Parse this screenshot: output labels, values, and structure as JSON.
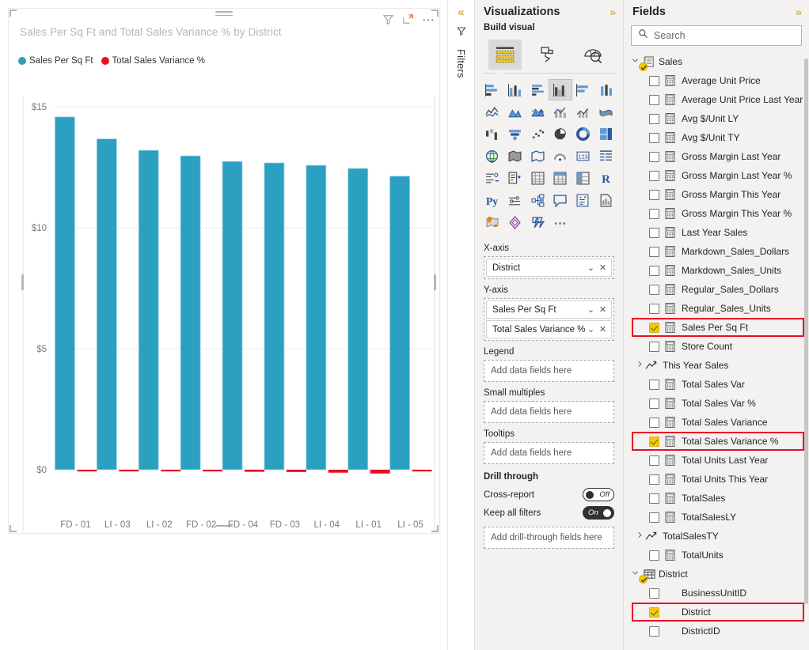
{
  "canvas": {
    "visual": {
      "title": "Sales Per Sq Ft and Total Sales Variance % by District",
      "header_icons": [
        {
          "name": "filter-icon",
          "label": "Filters"
        },
        {
          "name": "focus-mode-icon",
          "label": "Focus mode"
        },
        {
          "name": "more-options-icon",
          "label": "More options"
        }
      ],
      "legend": [
        {
          "label": "Sales Per Sq Ft",
          "color": "#2ba0c0"
        },
        {
          "label": "Total Sales Variance %",
          "color": "#e81123"
        }
      ]
    }
  },
  "chart_data": {
    "type": "bar",
    "title": "Sales Per Sq Ft and Total Sales Variance % by District",
    "xlabel": "District",
    "ylabel": "",
    "categories": [
      "FD - 01",
      "LI - 03",
      "LI - 02",
      "FD - 02",
      "FD - 04",
      "FD - 03",
      "LI - 04",
      "LI - 01",
      "LI - 05"
    ],
    "ytick_labels": [
      "$0",
      "$5",
      "$10",
      "$15"
    ],
    "ylim": [
      0,
      15
    ],
    "grid": true,
    "legend_position": "top-left",
    "series": [
      {
        "name": "Sales Per Sq Ft",
        "color": "#2ba0c0",
        "values": [
          14.58,
          13.67,
          13.2,
          12.97,
          12.74,
          12.68,
          12.58,
          12.45,
          12.13
        ]
      },
      {
        "name": "Total Sales Variance %",
        "color": "#e81123",
        "values": [
          -0.06,
          -0.07,
          -0.09,
          -0.08,
          -0.12,
          -0.13,
          -0.17,
          -0.22,
          -0.05
        ],
        "render": "thin-bar-near-zero"
      }
    ]
  },
  "filters_rail": {
    "expand_label": "«",
    "filter_icon": "filter-icon",
    "label": "Filters"
  },
  "visualizations": {
    "title": "Visualizations",
    "collapse_label": "»",
    "build_visual_label": "Build visual",
    "build_tabs": [
      {
        "name": "build-visual-tab",
        "icon": "fields-list-icon",
        "active": true
      },
      {
        "name": "format-visual-tab",
        "icon": "paint-roller-icon",
        "active": false
      },
      {
        "name": "analytics-tab",
        "icon": "magnifier-chart-icon",
        "active": false
      }
    ],
    "gallery_icons": [
      "stacked-bar-chart",
      "stacked-column-chart",
      "clustered-bar-chart",
      "clustered-column-chart",
      "100-stacked-bar-chart",
      "100-stacked-column-chart",
      "line-chart",
      "area-chart",
      "stacked-area-chart",
      "line-and-stacked-column-chart",
      "line-and-clustered-column-chart",
      "ribbon-chart",
      "waterfall-chart",
      "funnel-chart",
      "scatter-chart",
      "pie-chart",
      "donut-chart",
      "treemap",
      "map",
      "filled-map",
      "shape-map",
      "azure-map",
      "gauge",
      "card",
      "multi-row-card",
      "kpi",
      "slicer",
      "table",
      "matrix",
      "r-script-visual",
      "python-visual",
      "key-influencers",
      "decomposition-tree",
      "qa-visual",
      "smart-narrative",
      "paginated-report",
      "arcgis-map",
      "power-apps-visual",
      "power-automate-visual",
      "get-more-visuals"
    ],
    "wells": [
      {
        "label": "X-axis",
        "name": "x-axis-well",
        "fields": [
          {
            "text": "District"
          }
        ]
      },
      {
        "label": "Y-axis",
        "name": "y-axis-well",
        "fields": [
          {
            "text": "Sales Per Sq Ft"
          },
          {
            "text": "Total Sales Variance %"
          }
        ]
      },
      {
        "label": "Legend",
        "name": "legend-well",
        "placeholder": "Add data fields here",
        "fields": []
      },
      {
        "label": "Small multiples",
        "name": "small-multiples-well",
        "placeholder": "Add data fields here",
        "fields": []
      },
      {
        "label": "Tooltips",
        "name": "tooltips-well",
        "placeholder": "Add data fields here",
        "fields": []
      }
    ],
    "drill_through": {
      "heading": "Drill through",
      "cross_report": {
        "label": "Cross-report",
        "state": "Off",
        "on": false
      },
      "keep_all_filters": {
        "label": "Keep all filters",
        "state": "On",
        "on": true
      },
      "placeholder": "Add drill-through fields here"
    }
  },
  "fields": {
    "title": "Fields",
    "collapse_label": "»",
    "search_placeholder": "Search",
    "tables": [
      {
        "name": "Sales",
        "expanded": true,
        "checked": true,
        "icon": "table-measure-icon",
        "items": [
          {
            "label": "Average Unit Price",
            "checked": false,
            "icon": "measure-icon",
            "highlight": false
          },
          {
            "label": "Average Unit Price Last Year",
            "checked": false,
            "icon": "measure-icon",
            "highlight": false
          },
          {
            "label": "Avg $/Unit LY",
            "checked": false,
            "icon": "measure-icon",
            "highlight": false
          },
          {
            "label": "Avg $/Unit TY",
            "checked": false,
            "icon": "measure-icon",
            "highlight": false
          },
          {
            "label": "Gross Margin Last Year",
            "checked": false,
            "icon": "measure-icon",
            "highlight": false
          },
          {
            "label": "Gross Margin Last Year %",
            "checked": false,
            "icon": "measure-icon",
            "highlight": false
          },
          {
            "label": "Gross Margin This Year",
            "checked": false,
            "icon": "measure-icon",
            "highlight": false
          },
          {
            "label": "Gross Margin This Year %",
            "checked": false,
            "icon": "measure-icon",
            "highlight": false
          },
          {
            "label": "Last Year Sales",
            "checked": false,
            "icon": "measure-icon",
            "highlight": false
          },
          {
            "label": "Markdown_Sales_Dollars",
            "checked": false,
            "icon": "measure-icon",
            "highlight": false
          },
          {
            "label": "Markdown_Sales_Units",
            "checked": false,
            "icon": "measure-icon",
            "highlight": false
          },
          {
            "label": "Regular_Sales_Dollars",
            "checked": false,
            "icon": "measure-icon",
            "highlight": false
          },
          {
            "label": "Regular_Sales_Units",
            "checked": false,
            "icon": "measure-icon",
            "highlight": false
          },
          {
            "label": "Sales Per Sq Ft",
            "checked": true,
            "icon": "measure-icon",
            "highlight": true
          },
          {
            "label": "Store Count",
            "checked": false,
            "icon": "measure-icon",
            "highlight": false
          },
          {
            "label": "This Year Sales",
            "checked": false,
            "icon": "folder-measure-icon",
            "group": true,
            "expanded": false,
            "highlight": false
          },
          {
            "label": "Total Sales Var",
            "checked": false,
            "icon": "measure-icon",
            "highlight": false
          },
          {
            "label": "Total Sales Var %",
            "checked": false,
            "icon": "measure-icon",
            "highlight": false
          },
          {
            "label": "Total Sales Variance",
            "checked": false,
            "icon": "measure-icon",
            "highlight": false
          },
          {
            "label": "Total Sales Variance %",
            "checked": true,
            "icon": "measure-icon",
            "highlight": true
          },
          {
            "label": "Total Units Last Year",
            "checked": false,
            "icon": "measure-icon",
            "highlight": false
          },
          {
            "label": "Total Units This Year",
            "checked": false,
            "icon": "measure-icon",
            "highlight": false
          },
          {
            "label": "TotalSales",
            "checked": false,
            "icon": "measure-icon",
            "highlight": false
          },
          {
            "label": "TotalSalesLY",
            "checked": false,
            "icon": "measure-icon",
            "highlight": false
          },
          {
            "label": "TotalSalesTY",
            "checked": false,
            "icon": "folder-measure-icon",
            "group": true,
            "expanded": false,
            "highlight": false
          },
          {
            "label": "TotalUnits",
            "checked": false,
            "icon": "measure-icon",
            "highlight": false
          }
        ]
      },
      {
        "name": "District",
        "expanded": true,
        "checked": true,
        "icon": "table-icon",
        "items": [
          {
            "label": "BusinessUnitID",
            "checked": false,
            "icon": "none",
            "highlight": false
          },
          {
            "label": "District",
            "checked": true,
            "icon": "none",
            "highlight": true
          },
          {
            "label": "DistrictID",
            "checked": false,
            "icon": "none",
            "highlight": false
          }
        ]
      }
    ]
  }
}
